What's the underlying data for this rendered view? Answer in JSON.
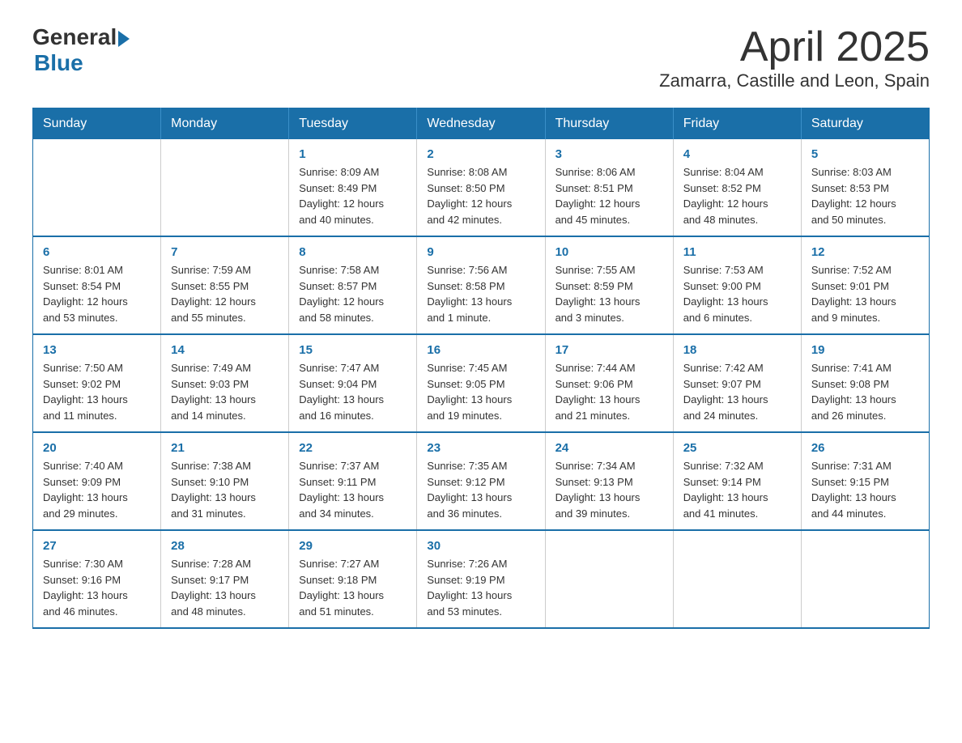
{
  "header": {
    "logo_general": "General",
    "logo_blue": "Blue",
    "title": "April 2025",
    "subtitle": "Zamarra, Castille and Leon, Spain"
  },
  "calendar": {
    "days_of_week": [
      "Sunday",
      "Monday",
      "Tuesday",
      "Wednesday",
      "Thursday",
      "Friday",
      "Saturday"
    ],
    "weeks": [
      [
        {
          "day": "",
          "info": ""
        },
        {
          "day": "",
          "info": ""
        },
        {
          "day": "1",
          "info": "Sunrise: 8:09 AM\nSunset: 8:49 PM\nDaylight: 12 hours\nand 40 minutes."
        },
        {
          "day": "2",
          "info": "Sunrise: 8:08 AM\nSunset: 8:50 PM\nDaylight: 12 hours\nand 42 minutes."
        },
        {
          "day": "3",
          "info": "Sunrise: 8:06 AM\nSunset: 8:51 PM\nDaylight: 12 hours\nand 45 minutes."
        },
        {
          "day": "4",
          "info": "Sunrise: 8:04 AM\nSunset: 8:52 PM\nDaylight: 12 hours\nand 48 minutes."
        },
        {
          "day": "5",
          "info": "Sunrise: 8:03 AM\nSunset: 8:53 PM\nDaylight: 12 hours\nand 50 minutes."
        }
      ],
      [
        {
          "day": "6",
          "info": "Sunrise: 8:01 AM\nSunset: 8:54 PM\nDaylight: 12 hours\nand 53 minutes."
        },
        {
          "day": "7",
          "info": "Sunrise: 7:59 AM\nSunset: 8:55 PM\nDaylight: 12 hours\nand 55 minutes."
        },
        {
          "day": "8",
          "info": "Sunrise: 7:58 AM\nSunset: 8:57 PM\nDaylight: 12 hours\nand 58 minutes."
        },
        {
          "day": "9",
          "info": "Sunrise: 7:56 AM\nSunset: 8:58 PM\nDaylight: 13 hours\nand 1 minute."
        },
        {
          "day": "10",
          "info": "Sunrise: 7:55 AM\nSunset: 8:59 PM\nDaylight: 13 hours\nand 3 minutes."
        },
        {
          "day": "11",
          "info": "Sunrise: 7:53 AM\nSunset: 9:00 PM\nDaylight: 13 hours\nand 6 minutes."
        },
        {
          "day": "12",
          "info": "Sunrise: 7:52 AM\nSunset: 9:01 PM\nDaylight: 13 hours\nand 9 minutes."
        }
      ],
      [
        {
          "day": "13",
          "info": "Sunrise: 7:50 AM\nSunset: 9:02 PM\nDaylight: 13 hours\nand 11 minutes."
        },
        {
          "day": "14",
          "info": "Sunrise: 7:49 AM\nSunset: 9:03 PM\nDaylight: 13 hours\nand 14 minutes."
        },
        {
          "day": "15",
          "info": "Sunrise: 7:47 AM\nSunset: 9:04 PM\nDaylight: 13 hours\nand 16 minutes."
        },
        {
          "day": "16",
          "info": "Sunrise: 7:45 AM\nSunset: 9:05 PM\nDaylight: 13 hours\nand 19 minutes."
        },
        {
          "day": "17",
          "info": "Sunrise: 7:44 AM\nSunset: 9:06 PM\nDaylight: 13 hours\nand 21 minutes."
        },
        {
          "day": "18",
          "info": "Sunrise: 7:42 AM\nSunset: 9:07 PM\nDaylight: 13 hours\nand 24 minutes."
        },
        {
          "day": "19",
          "info": "Sunrise: 7:41 AM\nSunset: 9:08 PM\nDaylight: 13 hours\nand 26 minutes."
        }
      ],
      [
        {
          "day": "20",
          "info": "Sunrise: 7:40 AM\nSunset: 9:09 PM\nDaylight: 13 hours\nand 29 minutes."
        },
        {
          "day": "21",
          "info": "Sunrise: 7:38 AM\nSunset: 9:10 PM\nDaylight: 13 hours\nand 31 minutes."
        },
        {
          "day": "22",
          "info": "Sunrise: 7:37 AM\nSunset: 9:11 PM\nDaylight: 13 hours\nand 34 minutes."
        },
        {
          "day": "23",
          "info": "Sunrise: 7:35 AM\nSunset: 9:12 PM\nDaylight: 13 hours\nand 36 minutes."
        },
        {
          "day": "24",
          "info": "Sunrise: 7:34 AM\nSunset: 9:13 PM\nDaylight: 13 hours\nand 39 minutes."
        },
        {
          "day": "25",
          "info": "Sunrise: 7:32 AM\nSunset: 9:14 PM\nDaylight: 13 hours\nand 41 minutes."
        },
        {
          "day": "26",
          "info": "Sunrise: 7:31 AM\nSunset: 9:15 PM\nDaylight: 13 hours\nand 44 minutes."
        }
      ],
      [
        {
          "day": "27",
          "info": "Sunrise: 7:30 AM\nSunset: 9:16 PM\nDaylight: 13 hours\nand 46 minutes."
        },
        {
          "day": "28",
          "info": "Sunrise: 7:28 AM\nSunset: 9:17 PM\nDaylight: 13 hours\nand 48 minutes."
        },
        {
          "day": "29",
          "info": "Sunrise: 7:27 AM\nSunset: 9:18 PM\nDaylight: 13 hours\nand 51 minutes."
        },
        {
          "day": "30",
          "info": "Sunrise: 7:26 AM\nSunset: 9:19 PM\nDaylight: 13 hours\nand 53 minutes."
        },
        {
          "day": "",
          "info": ""
        },
        {
          "day": "",
          "info": ""
        },
        {
          "day": "",
          "info": ""
        }
      ]
    ]
  }
}
